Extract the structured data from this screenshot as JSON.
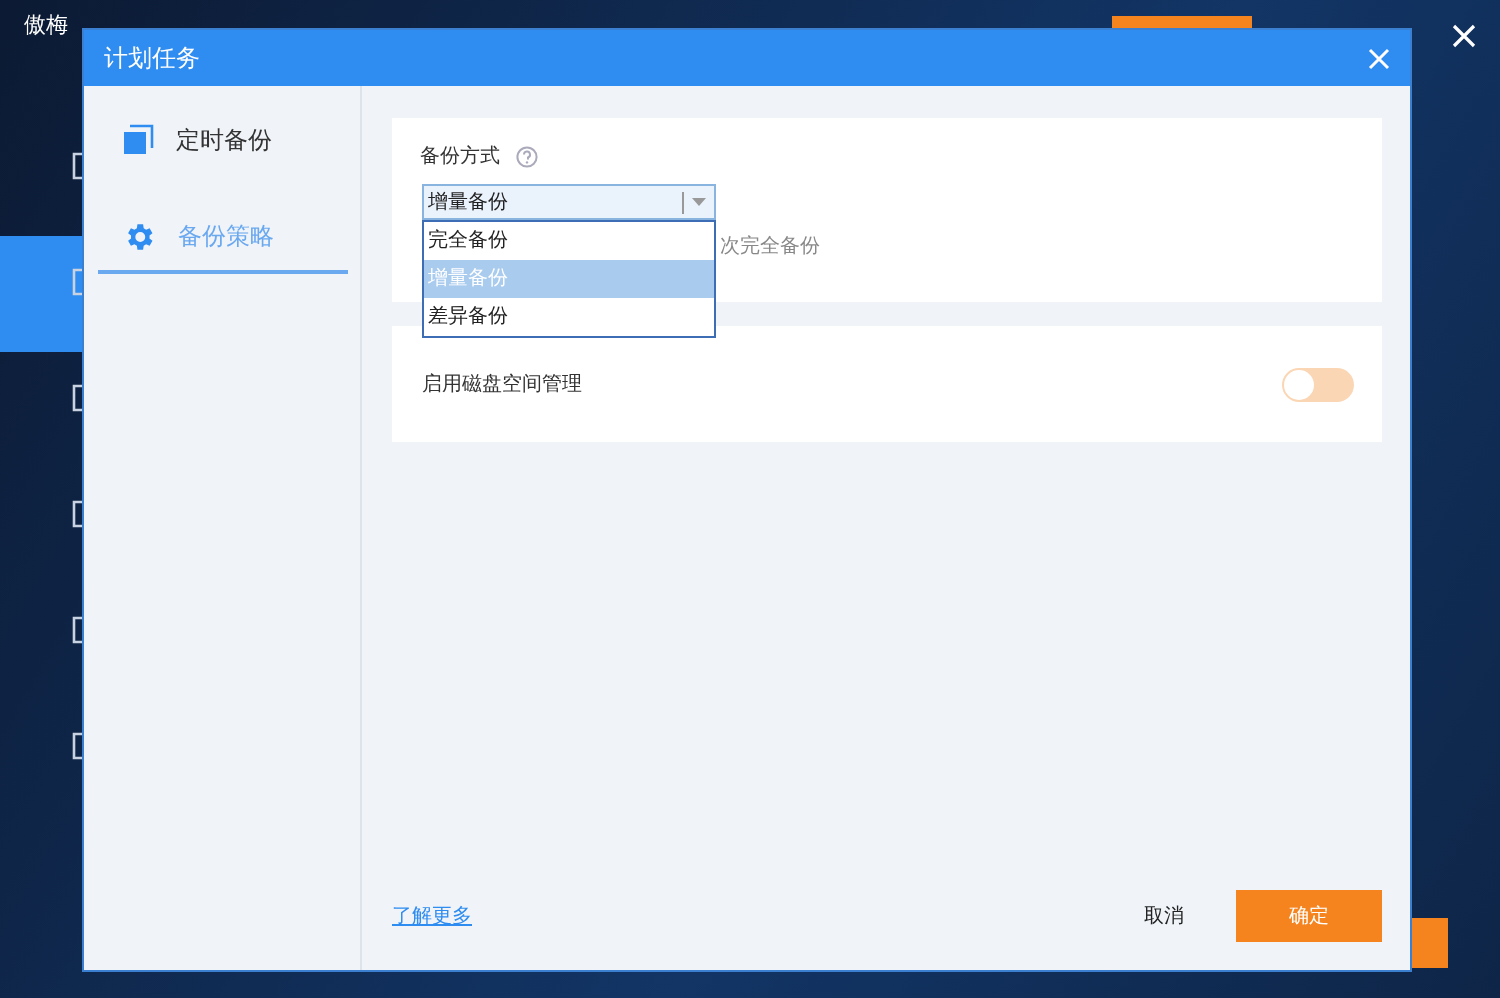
{
  "app": {
    "title": "傲梅",
    "nav": [
      {
        "selected": false
      },
      {
        "selected": true
      },
      {
        "selected": false
      },
      {
        "selected": false
      },
      {
        "selected": false
      },
      {
        "selected": false
      }
    ]
  },
  "dialog": {
    "title": "计划任务"
  },
  "sidebar": {
    "items": [
      {
        "label": "定时备份",
        "kind": "schedule",
        "selected": false
      },
      {
        "label": "备份策略",
        "kind": "strategy",
        "selected": true
      }
    ]
  },
  "backup_method": {
    "label": "备份方式",
    "value": "增量备份",
    "expanded": true,
    "options": [
      {
        "label": "完全备份",
        "selected": false
      },
      {
        "label": "增量备份",
        "selected": true
      },
      {
        "label": "差异备份",
        "selected": false
      }
    ],
    "partial_text": "次完全备份"
  },
  "disk_management": {
    "label": "启用磁盘空间管理",
    "on": false
  },
  "footer": {
    "link": "了解更多",
    "cancel": "取消",
    "ok": "确定"
  }
}
